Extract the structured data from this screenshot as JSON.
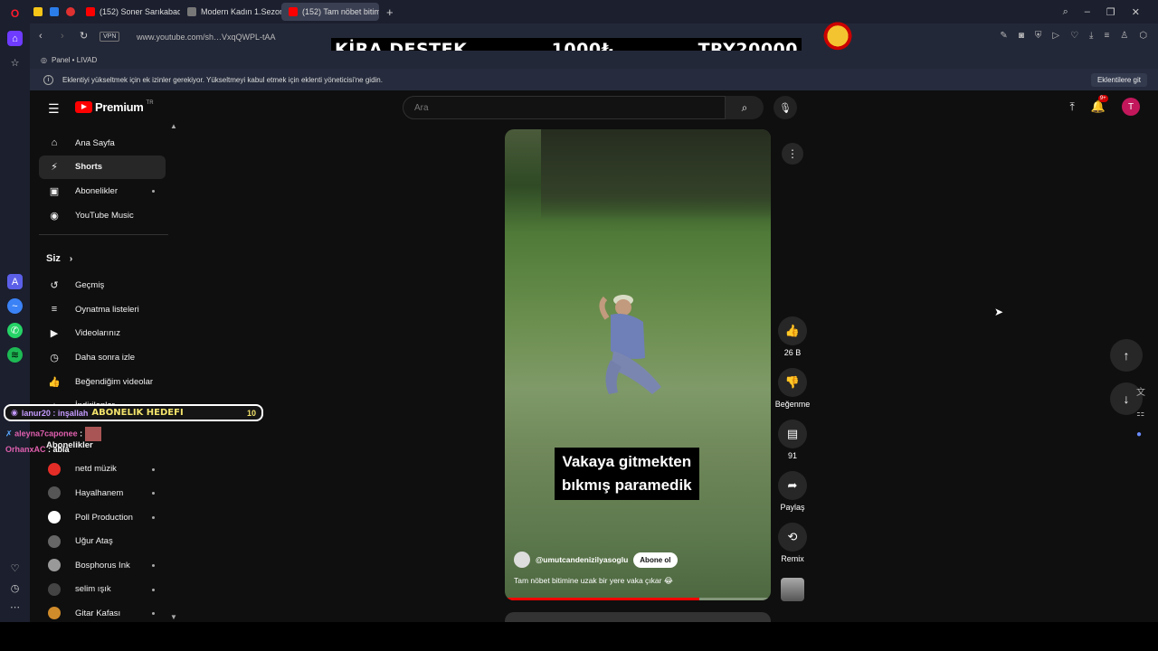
{
  "browser": {
    "tabs": [
      {
        "title": "(152) Soner Sarıkabaday",
        "color": "#ff0000"
      },
      {
        "title": "Modern Kadın 1.Sezon 8.B",
        "color": "#777777"
      },
      {
        "title": "(152) Tam nöbet bitimi",
        "color": "#ff0000",
        "active": true
      }
    ],
    "url": "www.youtube.com/sh…VxqQWPL-tAA",
    "vpn_label": "VPN",
    "bookmark": "Panel • LIVAD",
    "info_message": "Eklentiyi yükseltmek için ek izinler gerekiyor. Yükseltmeyi kabul etmek için eklenti yöneticisi'ne gidin.",
    "info_button": "Eklentilere git"
  },
  "banner": {
    "left": "KİRA DESTEK",
    "mid": "1000₺",
    "right": "TRY20000"
  },
  "youtube": {
    "logo_text": "Premium",
    "logo_sup": "TR",
    "search_placeholder": "Ara",
    "notif_badge": "9+",
    "avatar_letter": "T",
    "nav": [
      {
        "label": "Ana Sayfa",
        "icon": "home-icon"
      },
      {
        "label": "Shorts",
        "icon": "shorts-icon",
        "active": true
      },
      {
        "label": "Abonelikler",
        "icon": "subscriptions-icon",
        "dot": true
      },
      {
        "label": "YouTube Music",
        "icon": "music-icon"
      }
    ],
    "you_heading": "Siz",
    "you_items": [
      {
        "label": "Geçmiş",
        "icon": "history-icon"
      },
      {
        "label": "Oynatma listeleri",
        "icon": "playlist-icon"
      },
      {
        "label": "Videolarınız",
        "icon": "your-videos-icon"
      },
      {
        "label": "Daha sonra izle",
        "icon": "clock-icon"
      },
      {
        "label": "Beğendiğim videolar",
        "icon": "like-icon"
      },
      {
        "label": "İndirilenler",
        "icon": "download-icon"
      }
    ],
    "subs_heading": "Abonelikler",
    "subscriptions": [
      {
        "label": "netd müzik",
        "color": "#e52d27",
        "dot": true
      },
      {
        "label": "Hayalhanem",
        "color": "#555555",
        "dot": true
      },
      {
        "label": "Poll Production",
        "color": "#ffffff",
        "dot": true
      },
      {
        "label": "Uğur Ataş",
        "color": "#666666",
        "dot": false
      },
      {
        "label": "Bosphorus Ink",
        "color": "#999999",
        "dot": true
      },
      {
        "label": "selim ışık",
        "color": "#444444",
        "dot": true
      },
      {
        "label": "Gitar Kafası",
        "color": "#d08b2a",
        "dot": true
      }
    ],
    "video": {
      "caption_line1": "Vakaya gitmekten",
      "caption_line2": "bıkmış paramedik",
      "channel": "@umutcandenizilyasoglu",
      "subscribe": "Abone ol",
      "description": "Tam nöbet bitimine uzak bir yere vaka çıkar 😂",
      "progress": 0.73
    },
    "actions": {
      "likes": "26 B",
      "dislike": "Beğenme",
      "comments": "91",
      "share": "Paylaş",
      "remix": "Remix"
    }
  },
  "stream": {
    "goal_user": "lanur20 : inşallah",
    "goal_title": "ABONELIK HEDEFI",
    "goal_count": "10",
    "chat": [
      {
        "user": "aleyna7caponee",
        "text": ":",
        "color": "#e05fae"
      },
      {
        "user": "OrhanxAC",
        "text": ": abla",
        "color": "#e05fae"
      }
    ]
  }
}
